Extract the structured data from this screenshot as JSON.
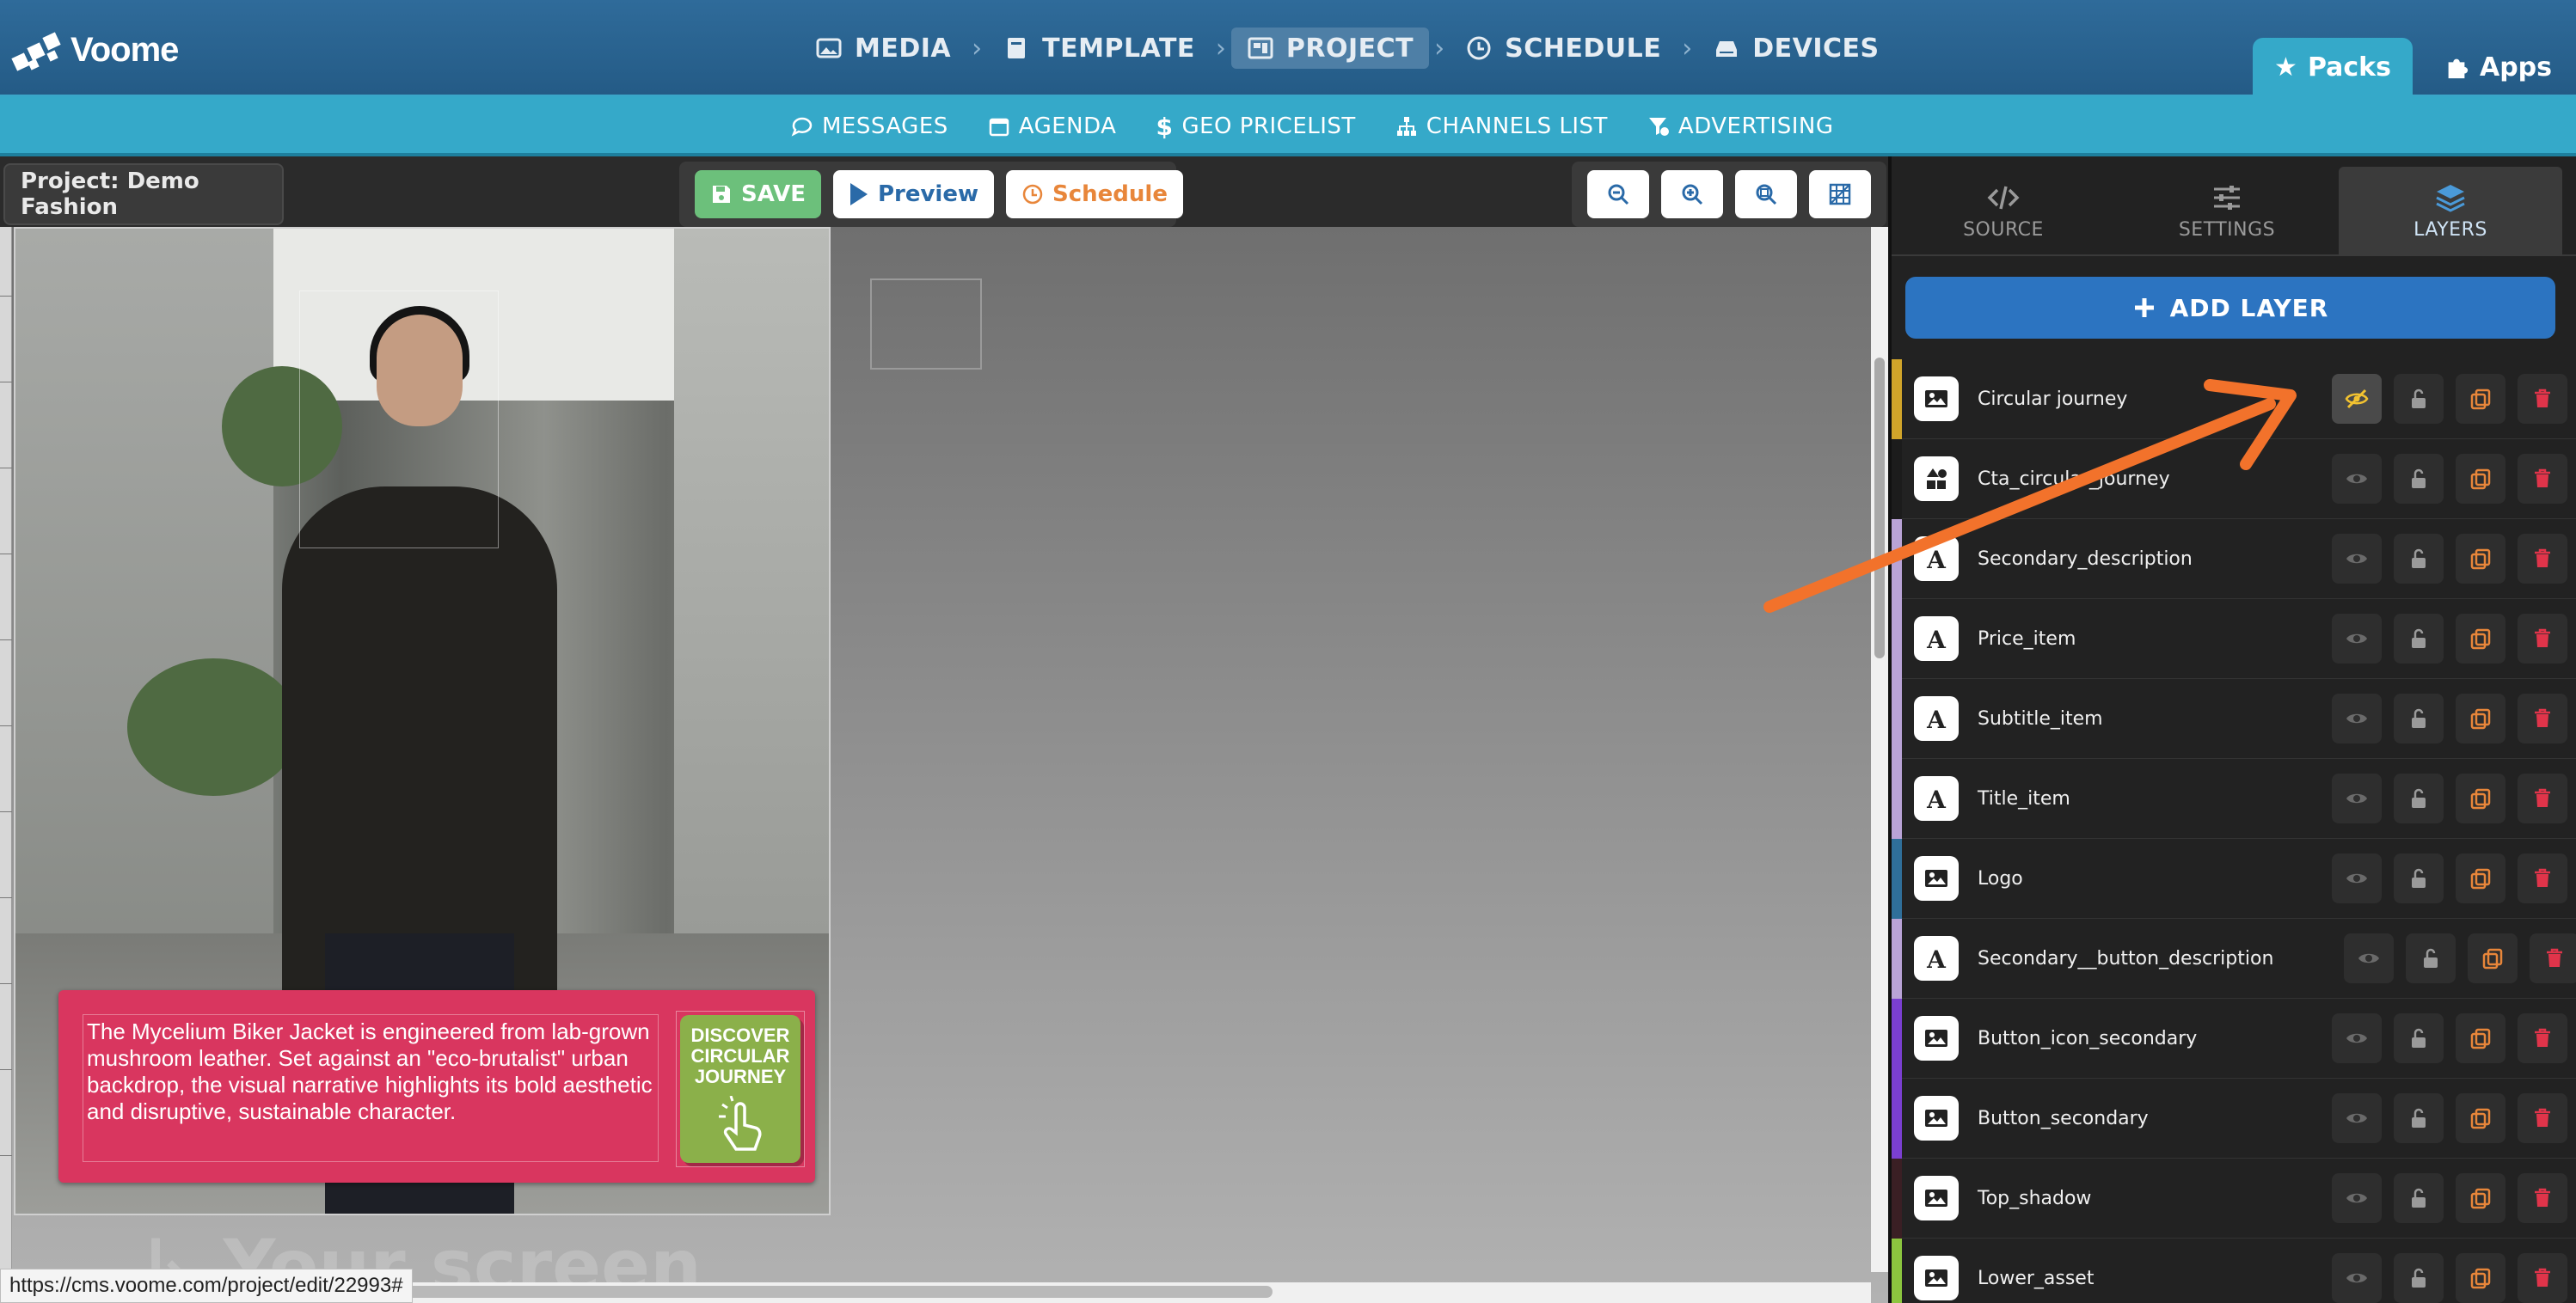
{
  "brand": {
    "name": "Voome"
  },
  "nav": {
    "items": [
      {
        "label": "MEDIA",
        "icon": "image-icon"
      },
      {
        "label": "TEMPLATE",
        "icon": "book-icon"
      },
      {
        "label": "PROJECT",
        "icon": "project-icon",
        "active": true
      },
      {
        "label": "SCHEDULE",
        "icon": "clock-icon"
      },
      {
        "label": "DEVICES",
        "icon": "devices-icon"
      }
    ],
    "packs_label": "Packs",
    "apps_label": "Apps"
  },
  "subnav": {
    "items": [
      {
        "label": "MESSAGES",
        "icon": "chat-icon"
      },
      {
        "label": "AGENDA",
        "icon": "calendar-icon"
      },
      {
        "label": "GEO PRICELIST",
        "icon": "dollar-icon"
      },
      {
        "label": "CHANNELS LIST",
        "icon": "sitemap-icon"
      },
      {
        "label": "ADVERTISING",
        "icon": "funnel-dollar-icon"
      }
    ]
  },
  "toolbar": {
    "project_label": "Project: Demo Fashion",
    "save_label": "SAVE",
    "preview_label": "Preview",
    "schedule_label": "Schedule"
  },
  "canvas": {
    "description_text": "The Mycelium Biker Jacket is engineered from lab-grown mushroom leather. Set against an \"eco-brutalist\" urban backdrop, the visual narrative highlights its bold aesthetic and disruptive, sustainable character.",
    "cta_label": "DISCOVER CIRCULAR JOURNEY",
    "watermark": "↳ Your screen"
  },
  "status_url": "https://cms.voome.com/project/edit/22993#",
  "panel": {
    "tabs": [
      {
        "label": "SOURCE",
        "icon": "code-icon"
      },
      {
        "label": "SETTINGS",
        "icon": "sliders-icon"
      },
      {
        "label": "LAYERS",
        "icon": "layers-icon",
        "active": true
      }
    ],
    "add_layer_label": "ADD LAYER",
    "layers": [
      {
        "name": "Circular journey",
        "type": "image",
        "stripe": "#d1a52a",
        "hidden": true
      },
      {
        "name": "Cta_circular_journey",
        "type": "shapes",
        "stripe": "#1c1c1c"
      },
      {
        "name": "Secondary_description",
        "type": "text",
        "stripe": "#b9a3d6"
      },
      {
        "name": "Price_item",
        "type": "text",
        "stripe": "#b9a3d6"
      },
      {
        "name": "Subtitle_item",
        "type": "text",
        "stripe": "#b9a3d6"
      },
      {
        "name": "Title_item",
        "type": "text",
        "stripe": "#b9a3d6"
      },
      {
        "name": "Logo",
        "type": "image",
        "stripe": "#2f6f9a"
      },
      {
        "name": "Secondary__button_description",
        "type": "text",
        "stripe": "#b9a3d6"
      },
      {
        "name": "Button_icon_secondary",
        "type": "image",
        "stripe": "#7b3fd1"
      },
      {
        "name": "Button_secondary",
        "type": "image",
        "stripe": "#7b3fd1"
      },
      {
        "name": "Top_shadow",
        "type": "image",
        "stripe": "#3a1f24"
      },
      {
        "name": "Lower_asset",
        "type": "image",
        "stripe": "#8cc63f"
      }
    ]
  },
  "colors": {
    "accent_orange": "#f2722b",
    "eye_active": "#f2c230",
    "lock": "#9a9a9a",
    "copy": "#e8863a",
    "delete": "#e0344a"
  }
}
